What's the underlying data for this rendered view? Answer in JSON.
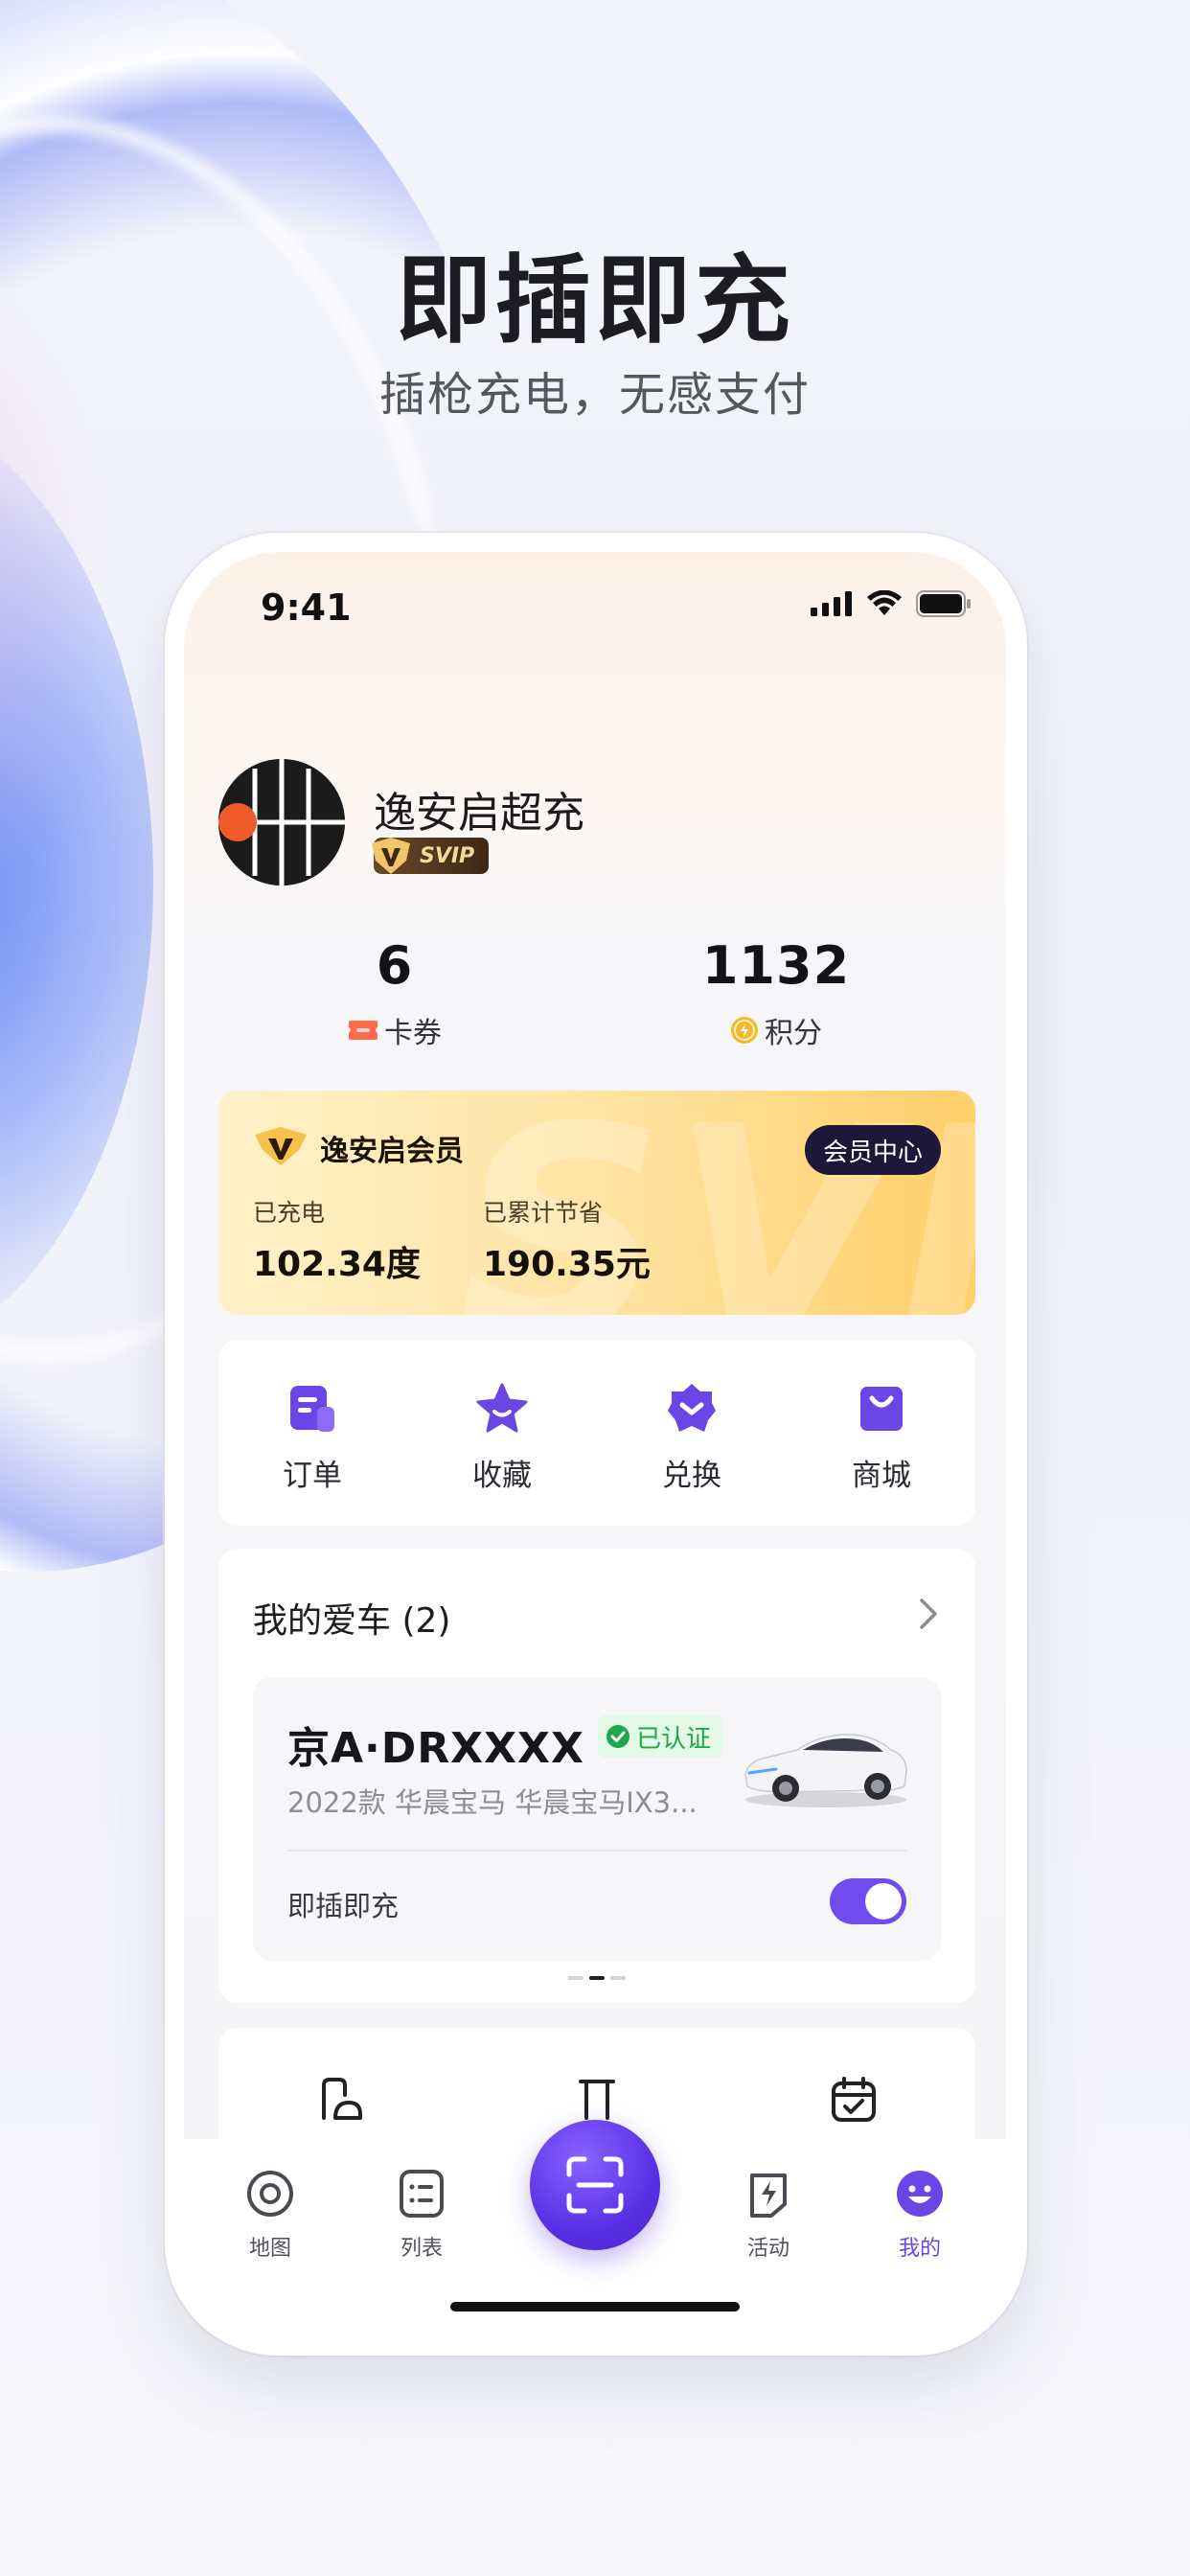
{
  "headline": "即插即充",
  "subline": "插枪充电，无感支付",
  "status_bar": {
    "time": "9:41"
  },
  "profile": {
    "name": "逸安启超充",
    "badge": "SVIP"
  },
  "stats": [
    {
      "value": "6",
      "label": "卡券",
      "icon": "coupon-icon"
    },
    {
      "value": "1132",
      "label": "积分",
      "icon": "points-coin-icon"
    }
  ],
  "vip_card": {
    "title": "逸安启会员",
    "button": "会员中心",
    "watermark": "SVIP",
    "charged_label": "已充电",
    "charged_value": "102.34度",
    "saved_label": "已累计节省",
    "saved_value": "190.35元"
  },
  "quick_actions": [
    {
      "label": "订单",
      "icon": "order-icon"
    },
    {
      "label": "收藏",
      "icon": "favorite-icon"
    },
    {
      "label": "兑换",
      "icon": "exchange-icon"
    },
    {
      "label": "商城",
      "icon": "shop-icon"
    }
  ],
  "cars": {
    "title": "我的爱车 (2)",
    "plate": "京A·DRXXXX",
    "verified": "已认证",
    "model": "2022款 华晨宝马 华晨宝马IX3...",
    "plug_charge_label": "即插即充",
    "plug_charge_on": true,
    "page_index": 2,
    "page_count": 3
  },
  "tabbar": [
    {
      "label": "地图",
      "icon": "map-pin-icon"
    },
    {
      "label": "列表",
      "icon": "list-icon"
    },
    {
      "label": "活动",
      "icon": "activity-bolt-icon"
    },
    {
      "label": "我的",
      "icon": "profile-smile-icon",
      "active": true
    }
  ],
  "colors": {
    "accent": "#6a46e6",
    "vip_gold": "#ffcf6a",
    "verified_green": "#1ea84a"
  }
}
